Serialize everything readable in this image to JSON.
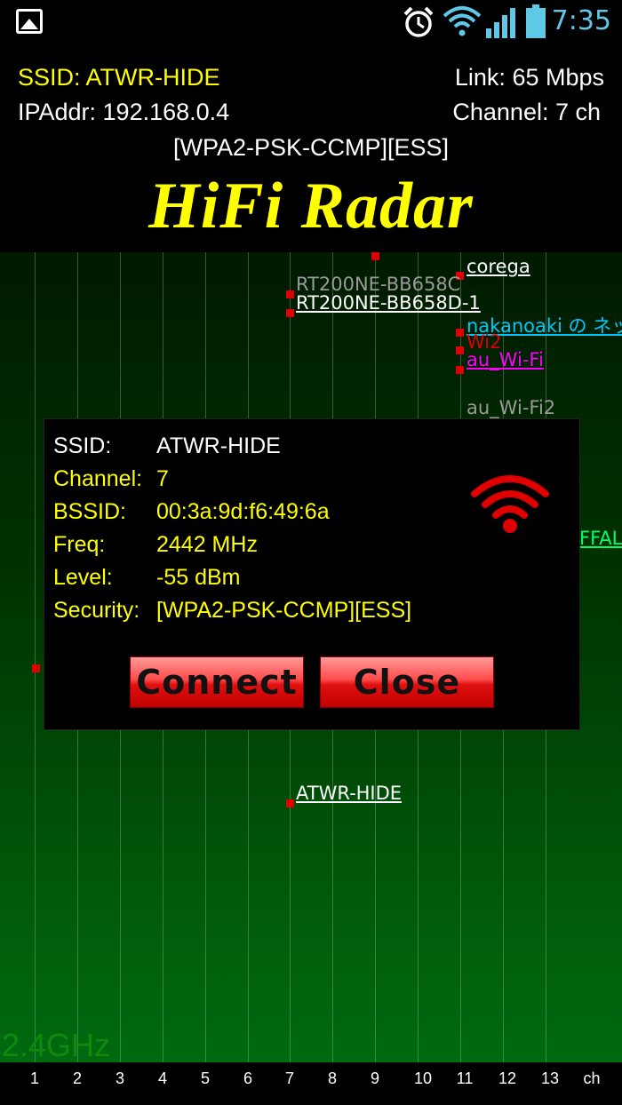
{
  "statusbar": {
    "time": "7:35",
    "icons": [
      "image-icon",
      "alarm-icon",
      "wifi-icon",
      "signal-icon",
      "battery-icon"
    ]
  },
  "header": {
    "ssid": "SSID: ATWR-HIDE",
    "ip": "IPAddr: 192.168.0.4",
    "link": "Link: 65 Mbps",
    "channel": "Channel: 7 ch",
    "security": "[WPA2-PSK-CCMP][ESS]",
    "app_title": "HiFi Radar"
  },
  "radar": {
    "band": "2.4GHz",
    "networks": [
      {
        "name": "corega",
        "channel": 11,
        "color": "#ffffff"
      },
      {
        "name": "RT200NE-BB658C",
        "channel": 7,
        "color": "#9a9a9a"
      },
      {
        "name": "RT200NE-BB658D-1",
        "channel": 7,
        "color": "#ffffff"
      },
      {
        "name": "nakanoaki の ネッ",
        "channel": 11,
        "color": "#00c8ff"
      },
      {
        "name": "Wi2",
        "channel": 11,
        "color": "#e00000"
      },
      {
        "name": "au_Wi-Fi",
        "channel": 11,
        "color": "#ff00ff"
      },
      {
        "name": "au_Wi-Fi2",
        "channel": 11,
        "color": "#9a9a9a"
      },
      {
        "name": "FFAL",
        "channel": 13,
        "color": "#00ff66"
      },
      {
        "name": "ATWR-HIDE",
        "channel": 7,
        "color": "#ffffff"
      }
    ]
  },
  "axis": {
    "ticks": [
      "1",
      "2",
      "3",
      "4",
      "5",
      "6",
      "7",
      "8",
      "9",
      "10",
      "11",
      "12",
      "13",
      "ch"
    ]
  },
  "dialog": {
    "rows": [
      {
        "label": "SSID:",
        "value": "ATWR-HIDE"
      },
      {
        "label": "Channel:",
        "value": "7"
      },
      {
        "label": "BSSID:",
        "value": "00:3a:9d:f6:49:6a"
      },
      {
        "label": "Freq:",
        "value": "2442 MHz"
      },
      {
        "label": "Level:",
        "value": "-55 dBm"
      },
      {
        "label": "Security:",
        "value": "[WPA2-PSK-CCMP][ESS]"
      }
    ],
    "connect_label": "Connect",
    "close_label": "Close"
  },
  "colors": {
    "accent_yellow": "#ffff00",
    "status_cyan": "#5ec8e6",
    "button_red": "#e01010"
  }
}
